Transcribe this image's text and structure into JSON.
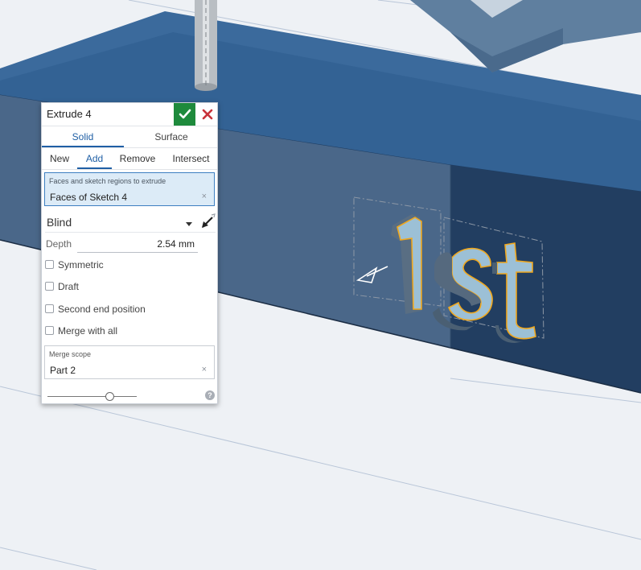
{
  "dialog": {
    "title": "Extrude 4",
    "confirm_icon": "checkmark-icon",
    "cancel_icon": "close-icon",
    "body_type_tabs": [
      {
        "label": "Solid",
        "active": true
      },
      {
        "label": "Surface",
        "active": false
      }
    ],
    "operations": [
      {
        "label": "New",
        "active": false
      },
      {
        "label": "Add",
        "active": true
      },
      {
        "label": "Remove",
        "active": false
      },
      {
        "label": "Intersect",
        "active": false
      }
    ],
    "selection": {
      "label": "Faces and sketch regions to extrude",
      "value": "Faces of Sketch 4",
      "clear": "×"
    },
    "end_type": {
      "value": "Blind",
      "dropdown_icon": "caret-down-icon",
      "flip_icon": "flip-direction-icon"
    },
    "depth": {
      "label": "Depth",
      "value": "2.54 mm"
    },
    "options": [
      {
        "label": "Symmetric",
        "checked": false
      },
      {
        "label": "Draft",
        "checked": false
      },
      {
        "label": "Second end position",
        "checked": false
      },
      {
        "label": "Merge with all",
        "checked": false
      }
    ],
    "merge_scope": {
      "label": "Merge scope",
      "value": "Part 2",
      "clear": "×"
    },
    "slider_value": 0.7,
    "help": "?"
  },
  "scene": {
    "extruded_text": "1st",
    "colors": {
      "background": "#eef1f5",
      "block_top": "#2b5482",
      "block_front": "#3a5878",
      "highlight": "#f0a81e",
      "confirm_green": "#1e8a3c",
      "cancel_red": "#c8323a",
      "accent": "#1f5fa5"
    }
  }
}
